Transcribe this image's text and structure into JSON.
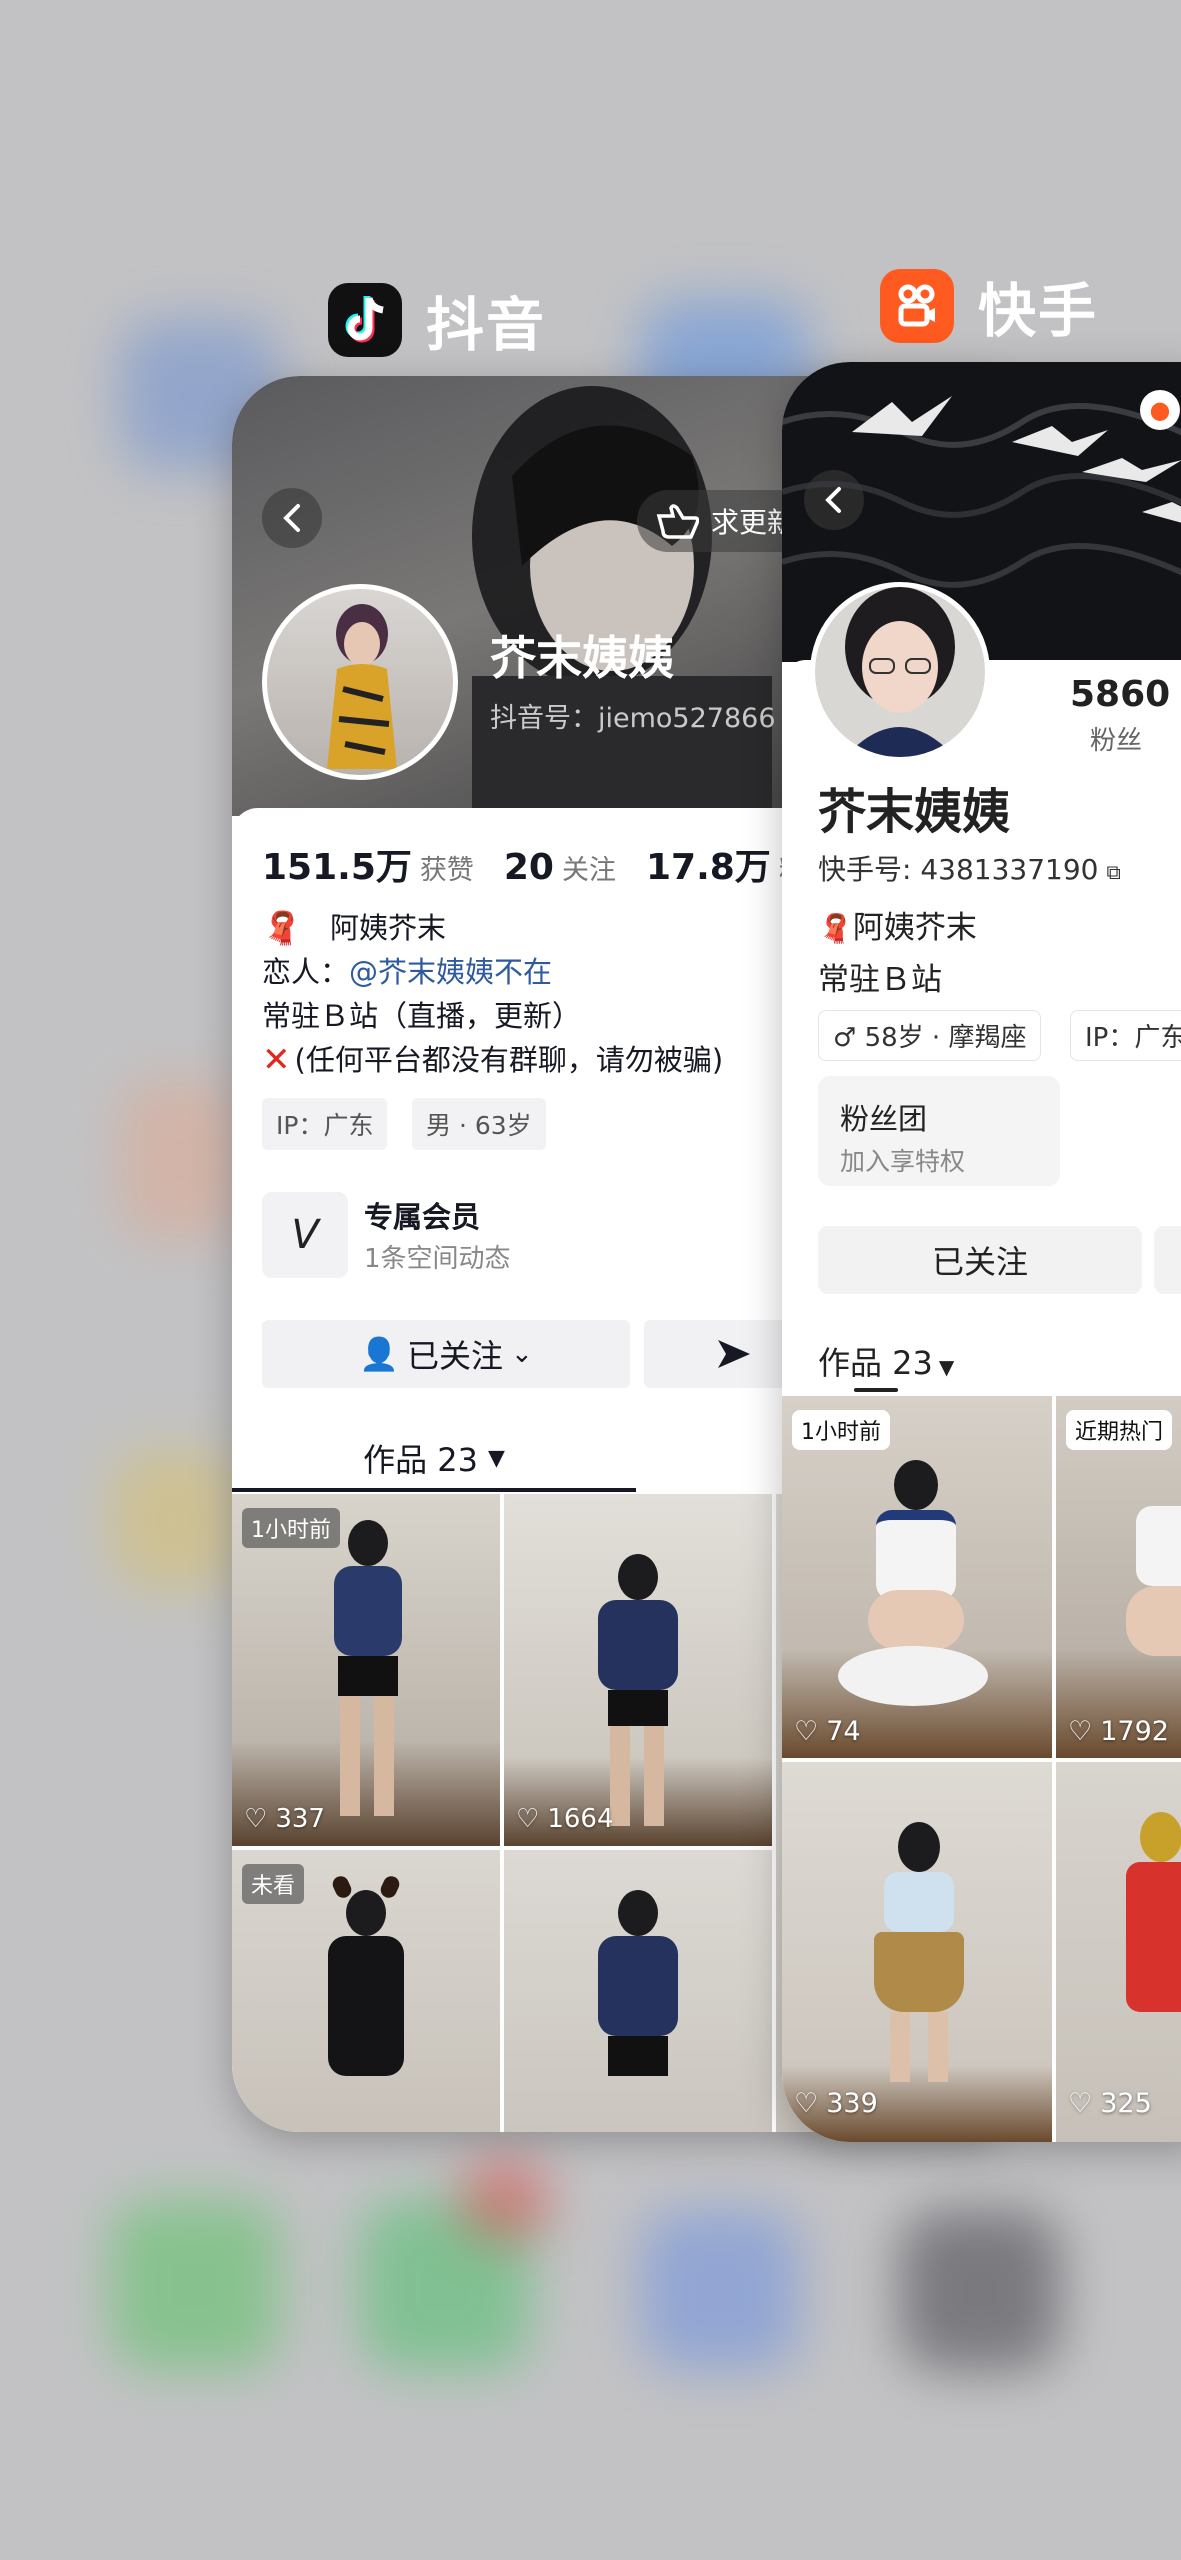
{
  "switcher": {
    "left_app": {
      "name": "抖音"
    },
    "right_app": {
      "name": "快手"
    }
  },
  "douyin": {
    "hint_button": "求更新",
    "nickname": "芥末姨姨",
    "id_label": "抖音号：jiemo527866",
    "stats": {
      "likes_value": "151.5万",
      "likes_label": "获赞",
      "following_value": "20",
      "following_label": "关注",
      "fans_value": "17.8万",
      "fans_label": "粉丝"
    },
    "bio": {
      "line1": "阿姨芥末",
      "lover_prefix": "恋人：",
      "lover_mention": "@芥末姨姨不在",
      "line3": "常驻Ｂ站（直播，更新）",
      "line4": "(任何平台都没有群聊，请勿被骗)"
    },
    "chips": [
      "IP：广东",
      "男 · 63岁"
    ],
    "member": {
      "title": "专属会员",
      "subtitle": "1条空间动态"
    },
    "follow_button": "已关注",
    "works_tab": "作品 23",
    "grid": [
      {
        "tag": "1小时前",
        "likes": "337"
      },
      {
        "tag": "",
        "likes": "1664"
      },
      {
        "tag": "未看",
        "likes": ""
      },
      {
        "tag": "",
        "likes": ""
      }
    ]
  },
  "kuaishou": {
    "fans_value": "5860",
    "fans_label": "粉丝",
    "nickname": "芥末姨姨",
    "id_label": "快手号: 4381337190",
    "bio_line1": "阿姨芥末",
    "bio_line2": "常驻Ｂ站",
    "chips": [
      "♂ 58岁 · 摩羯座",
      "IP：广东"
    ],
    "fan_group": {
      "title": "粉丝团",
      "subtitle": "加入享特权"
    },
    "follow_button": "已关注",
    "works_tab": "作品 23",
    "grid": [
      {
        "tag": "1小时前",
        "likes": "74"
      },
      {
        "tag": "近期热门",
        "likes": "1792"
      },
      {
        "tag": "",
        "likes": "339"
      },
      {
        "tag": "",
        "likes": "325"
      }
    ]
  }
}
